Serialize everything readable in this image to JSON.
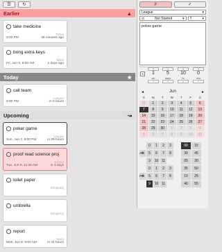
{
  "toolbar": {
    "list_icon": "list-icon",
    "refresh_icon": "refresh-icon"
  },
  "sections": {
    "earlier": {
      "title": "Earlier",
      "icon": "triangle-up-icon"
    },
    "today": {
      "title": "Today",
      "icon": "star-icon"
    },
    "upcoming": {
      "title": "Upcoming",
      "icon": "arrow-icon"
    }
  },
  "earlier_cards": [
    {
      "title": "take medicine",
      "cat": "Tasks",
      "when": "3:02 PM",
      "rel": "46 minutes ago"
    },
    {
      "title": "bring extra keys",
      "cat": "Work",
      "when": "Fri, Jun 5, 9:00 AM",
      "rel": "2 days ago"
    }
  ],
  "today_cards": [
    {
      "title": "call team",
      "cat": "League",
      "when": "9:00 PM",
      "rel": "in 5 hours"
    }
  ],
  "upcoming_cards": [
    {
      "title": "poker game",
      "cat": "League",
      "when": "Sun, Jun 7, 9:00 PM",
      "rel": "in 29 hours"
    },
    {
      "title": "proof read science proj",
      "cat": "School",
      "when": "Tue, Jun 9, 11:30 AM",
      "rel": "in 3 days"
    },
    {
      "title": "toilet paper",
      "cat": "Shopping",
      "when": "",
      "rel": ""
    },
    {
      "title": "umbrella",
      "cat": "Shopping",
      "when": "",
      "rel": ""
    },
    {
      "title": "report",
      "cat": "Work",
      "when": "Mon, Jun 8, 9:00 AM",
      "rel": "in 41 hours"
    }
  ],
  "editor": {
    "cancel": "✗",
    "save": "✓",
    "category": "League",
    "status": "Not Started",
    "priority": "!!",
    "notes": "poker game"
  },
  "duration": {
    "columns": [
      {
        "value": "1",
        "label": "wk"
      },
      {
        "value": "5",
        "label": "days"
      },
      {
        "value": "10",
        "label": "hr"
      },
      {
        "value": "0",
        "label": "min"
      }
    ]
  },
  "calendar": {
    "month": "Jun",
    "dow": [
      "S",
      "M",
      "T",
      "W",
      "T",
      "F",
      "S"
    ],
    "weeks": [
      [
        "31",
        "1",
        "2",
        "3",
        "4",
        "5",
        "6"
      ],
      [
        "7",
        "8",
        "9",
        "10",
        "11",
        "12",
        "13"
      ],
      [
        "14",
        "15",
        "16",
        "17",
        "18",
        "19",
        "20"
      ],
      [
        "21",
        "22",
        "23",
        "24",
        "25",
        "26",
        "27"
      ],
      [
        "28",
        "29",
        "30",
        "1",
        "2",
        "3",
        "4"
      ],
      [
        "5",
        "6",
        "7",
        "8",
        "9",
        "10",
        "11"
      ]
    ],
    "selected": "7"
  },
  "time": {
    "am_label": "AM",
    "pm_label": "PM",
    "hours_am": [
      [
        "",
        "0",
        "1",
        "2",
        "3",
        ""
      ],
      [
        "4",
        "5",
        "6",
        "7",
        "8",
        ""
      ],
      [
        "",
        "9",
        "10",
        "11",
        "",
        ""
      ]
    ],
    "hours_pm": [
      [
        "",
        "0",
        "1",
        "2",
        "3",
        ""
      ],
      [
        "4",
        "5",
        "6",
        "7",
        "8",
        ""
      ],
      [
        "",
        "9",
        "10",
        "11",
        "",
        ""
      ]
    ],
    "minutes": [
      "00",
      "15",
      "30",
      "45",
      "05",
      "20",
      "35",
      "50",
      "10",
      "25",
      "40",
      "55"
    ],
    "selected_hour_pm": "9",
    "selected_minute": "00"
  }
}
